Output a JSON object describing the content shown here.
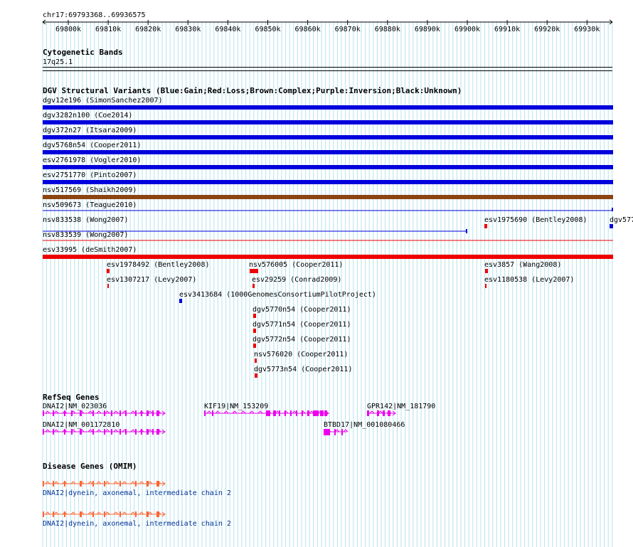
{
  "region": "chr17:69793368..69936575",
  "scale": {
    "ticks": [
      "69800k",
      "69810k",
      "69820k",
      "69830k",
      "69840k",
      "69850k",
      "69860k",
      "69870k",
      "69880k",
      "69890k",
      "69900k",
      "69910k",
      "69920k",
      "69930k"
    ]
  },
  "cyto": {
    "title": "Cytogenetic Bands",
    "band": "17q25.1"
  },
  "dgv": {
    "title": "DGV Structural Variants (Blue:Gain;Red:Loss;Brown:Complex;Purple:Inversion;Black:Unknown)",
    "colors": {
      "gain": "#0000dd",
      "loss": "#ee0000",
      "complex": "#8b4513"
    },
    "variants": [
      {
        "label": "dgv12e196 (SimonSanchez2007)",
        "type": "gain",
        "style": "full"
      },
      {
        "label": "dgv3282n100 (Coe2014)",
        "type": "gain",
        "style": "full"
      },
      {
        "label": "dgv372n27 (Itsara2009)",
        "type": "gain",
        "style": "full"
      },
      {
        "label": "dgv5768n54 (Cooper2011)",
        "type": "gain",
        "style": "full"
      },
      {
        "label": "esv2761978 (Vogler2010)",
        "type": "gain",
        "style": "full"
      },
      {
        "label": "esv2751770 (Pinto2007)",
        "type": "gain",
        "style": "full"
      },
      {
        "label": "nsv517569 (Shaikh2009)",
        "type": "complex",
        "style": "full"
      },
      {
        "label": "nsv509673 (Teague2010)",
        "type": "gain",
        "style": "thin"
      },
      {
        "label": "nsv833538 (Wong2007)",
        "type": "gain",
        "style": "partial"
      },
      {
        "label": "nsv833539 (Wong2007)",
        "type": "loss",
        "style": "thin"
      },
      {
        "label": "esv33995 (deSmith2007)",
        "type": "loss",
        "style": "full"
      }
    ],
    "small": [
      {
        "label": "esv1975690 (Bentley2008)",
        "type": "loss"
      },
      {
        "label": "dgv577",
        "type": "gain"
      },
      {
        "label": "esv1978492 (Bentley2008)",
        "type": "loss"
      },
      {
        "label": "nsv576005 (Cooper2011)",
        "type": "loss"
      },
      {
        "label": "esv3857 (Wang2008)",
        "type": "loss"
      },
      {
        "label": "esv1307217 (Levy2007)",
        "type": "loss"
      },
      {
        "label": "esv29259 (Conrad2009)",
        "type": "loss"
      },
      {
        "label": "esv1180538 (Levy2007)",
        "type": "loss"
      },
      {
        "label": "esv3413684 (1000GenomesConsortiumPilotProject)",
        "type": "gain"
      },
      {
        "label": "dgv5770n54 (Cooper2011)",
        "type": "loss"
      },
      {
        "label": "dgv5771n54 (Cooper2011)",
        "type": "loss"
      },
      {
        "label": "dgv5772n54 (Cooper2011)",
        "type": "loss"
      },
      {
        "label": "nsv576020 (Cooper2011)",
        "type": "loss"
      },
      {
        "label": "dgv5773n54 (Cooper2011)",
        "type": "loss"
      }
    ]
  },
  "refseq": {
    "title": "RefSeq Genes",
    "color": "#ee00ee",
    "genes": [
      {
        "label": "DNAI2|NM_023036"
      },
      {
        "label": "KIF19|NM_153209"
      },
      {
        "label": "GPR142|NM_181790"
      },
      {
        "label": "DNAI2|NM_001172810"
      },
      {
        "label": "BTBD17|NM_001080466"
      }
    ]
  },
  "omim": {
    "title": "Disease Genes (OMIM)",
    "color": "#ff6633",
    "entries": [
      {
        "label": "DNAI2|dynein, axonemal, intermediate chain 2"
      },
      {
        "label": "DNAI2|dynein, axonemal, intermediate chain 2"
      }
    ]
  }
}
